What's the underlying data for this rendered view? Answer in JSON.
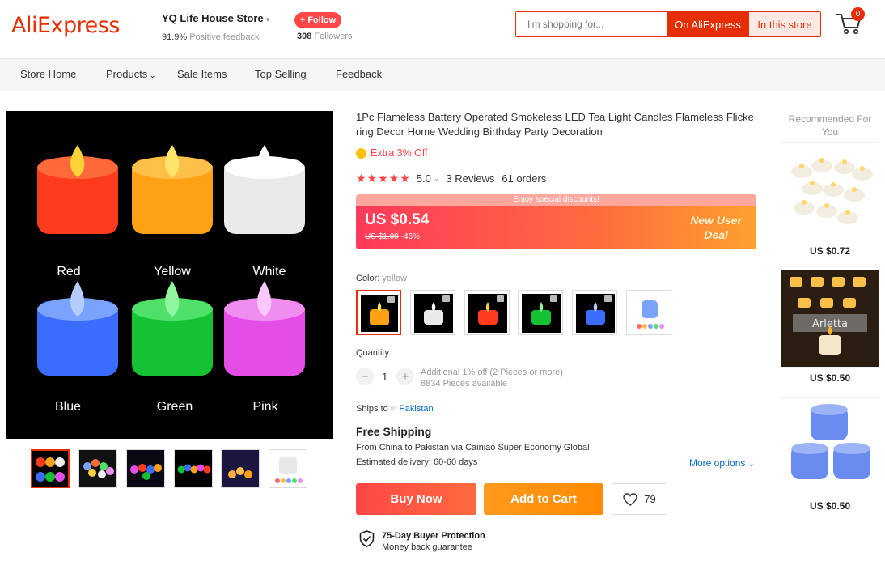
{
  "header": {
    "logo": "AliExpress",
    "store_name": "YQ Life House Store",
    "feedback_pct": "91.9%",
    "feedback_label": "Positive feedback",
    "follow_label": "+ Follow",
    "followers_count": "308",
    "followers_label": "Followers",
    "search_placeholder": "I'm shopping for...",
    "search_ali": "On AliExpress",
    "search_store": "In this store",
    "cart_count": "0"
  },
  "nav": [
    "Store Home",
    "Products",
    "Sale Items",
    "Top Selling",
    "Feedback"
  ],
  "gallery": {
    "labels": [
      "Red",
      "Yellow",
      "White",
      "Blue",
      "Green",
      "Pink"
    ],
    "candle_colors": [
      "#ff3b1e",
      "#ffa114",
      "#f4f4f4",
      "#3a6dff",
      "#14c234",
      "#e44ee6"
    ]
  },
  "product": {
    "title": "1Pc Flameless Battery Operated Smokeless LED Tea Light Candles Flameless Flickering Decor Home Wedding Birthday Party Decoration",
    "extra_off": "Extra 3% Off",
    "rating": "5.0",
    "reviews": "3 Reviews",
    "orders": "61 orders",
    "deal_banner": "Enjoy special discounts!",
    "price": "US $0.54",
    "orig_price": "US $1.00",
    "discount": "-46%",
    "new_user_line1": "New User",
    "new_user_line2": "Deal",
    "color_label": "Color:",
    "color_value": "yellow",
    "qty_label": "Quantity:",
    "qty_value": "1",
    "qty_info1": "Additional 1% off (2 Pieces or more)",
    "qty_info2": "8834 Pieces available",
    "ships_to": "Ships to",
    "ships_country": "Pakistan",
    "free_shipping": "Free Shipping",
    "ship_route": "From China to Pakistan via Cainiao Super Economy Global",
    "ship_est": "Estimated delivery: 60-60 days",
    "more_options": "More options",
    "buy_now": "Buy Now",
    "add_to_cart": "Add to Cart",
    "wish_count": "79",
    "protect_title": "75-Day Buyer Protection",
    "protect_sub": "Money back guarantee"
  },
  "recommended": {
    "title": "Recommended For You",
    "items": [
      {
        "price": "US $0.72"
      },
      {
        "price": "US $0.50"
      },
      {
        "price": "US $0.50"
      }
    ]
  }
}
